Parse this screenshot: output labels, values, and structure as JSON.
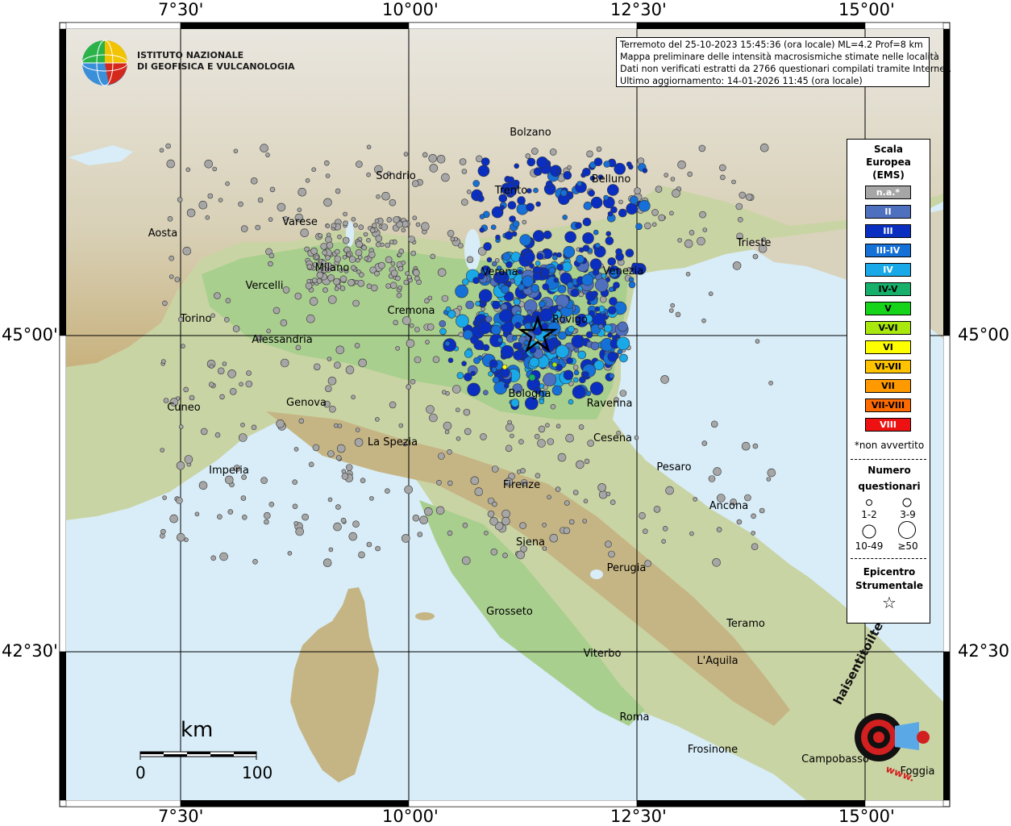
{
  "map": {
    "coords_top": [
      "7°30'",
      "10°00'",
      "12°30'",
      "15°00'"
    ],
    "coords_bottom": [
      "7°30'",
      "10°00'",
      "12°30'",
      "15°00'"
    ],
    "coords_left": [
      "45°00'",
      "42°30'"
    ],
    "coords_right": [
      "45°00'",
      "42°30'"
    ],
    "cities": [
      "Bolzano",
      "Sondrio",
      "Trento",
      "Belluno",
      "Varese",
      "Aosta",
      "Milano",
      "Verona",
      "Venezia",
      "Trieste",
      "Vercelli",
      "Cremona",
      "Rovigo",
      "Torino",
      "Alessandria",
      "Genova",
      "Bologna",
      "Ravenna",
      "Cuneo",
      "La Spezia",
      "Cesena",
      "Pesaro",
      "Imperia",
      "Firenze",
      "Ancona",
      "Siena",
      "Perugia",
      "Grosseto",
      "Teramo",
      "Viterbo",
      "L'Aquila",
      "Roma",
      "Frosinone",
      "Campobasso",
      "Foggia"
    ]
  },
  "info": {
    "line1": "Terremoto del 25-10-2023 15:45:36 (ora locale) ML=4.2 Prof=8 km",
    "line2": "Mappa preliminare delle intensità macrosismiche stimate nelle località",
    "line3": "Dati non verificati estratti da 2766 questionari compilati tramite Internet.",
    "line4": "Ultimo aggiornamento: 14-01-2026 11:45 (ora locale)"
  },
  "logo": {
    "line1": "ISTITUTO NAZIONALE",
    "line2": "DI GEOFISICA E VULCANOLOGIA",
    "hsit": "haisentitoilterremoto.it",
    "www": "www."
  },
  "legend": {
    "title1": "Scala",
    "title2": "Europea",
    "title3": "(EMS)",
    "levels": [
      {
        "label": "n.a.*",
        "color": "#a6a6a6",
        "text": "#ffffff"
      },
      {
        "label": "II",
        "color": "#4f6fbf",
        "text": "#ffffff"
      },
      {
        "label": "III",
        "color": "#0a2fc0",
        "text": "#ffffff"
      },
      {
        "label": "III-IV",
        "color": "#1570d8",
        "text": "#ffffff"
      },
      {
        "label": "IV",
        "color": "#19a8e8",
        "text": "#ffffff"
      },
      {
        "label": "IV-V",
        "color": "#17b06a",
        "text": "#000000"
      },
      {
        "label": "V",
        "color": "#16d41a",
        "text": "#000000"
      },
      {
        "label": "V-VI",
        "color": "#a8e80c",
        "text": "#000000"
      },
      {
        "label": "VI",
        "color": "#ffff00",
        "text": "#000000"
      },
      {
        "label": "VI-VII",
        "color": "#ffc300",
        "text": "#000000"
      },
      {
        "label": "VII",
        "color": "#ff9900",
        "text": "#000000"
      },
      {
        "label": "VII-VIII",
        "color": "#ff6a00",
        "text": "#000000"
      },
      {
        "label": "VIII",
        "color": "#ee1111",
        "text": "#ffffff"
      }
    ],
    "note": "*non avvertito",
    "count_title1": "Numero",
    "count_title2": "questionari",
    "count_ranges": [
      "1-2",
      "3-9",
      "10-49",
      "≥50"
    ],
    "epi_title1": "Epicentro",
    "epi_title2": "Strumentale",
    "star": "☆"
  },
  "scale_bar": {
    "unit": "km",
    "min": "0",
    "max": "100"
  }
}
